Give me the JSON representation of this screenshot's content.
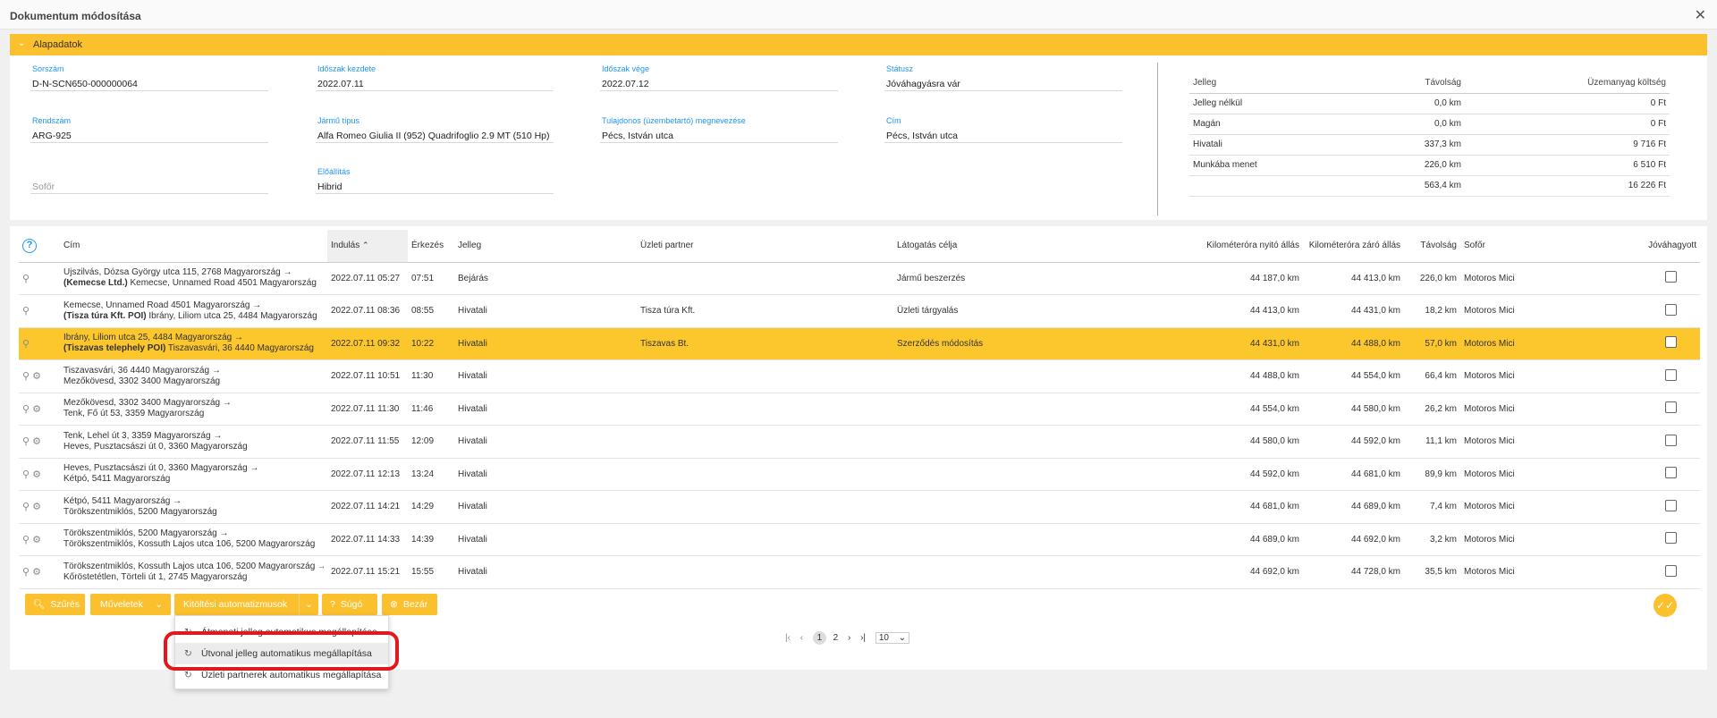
{
  "window": {
    "title": "Dokumentum módosítása",
    "close_icon": "close-icon"
  },
  "section": {
    "label": "Alapadatok"
  },
  "fields": {
    "sorszam": {
      "label": "Sorszám",
      "value": "D-N-SCN650-000000064"
    },
    "idoszak_kezdete": {
      "label": "Időszak kezdete",
      "value": "2022.07.11"
    },
    "idoszak_vege": {
      "label": "Időszak vége",
      "value": "2022.07.12"
    },
    "statusz": {
      "label": "Státusz",
      "value": "Jóváhagyásra vár"
    },
    "rendszam": {
      "label": "Rendszám",
      "value": "ARG-925"
    },
    "jarmu_tipus": {
      "label": "Jármű típus",
      "value": "Alfa Romeo Giulia II (952) Quadrifoglio 2.9 MT (510 Hp)"
    },
    "tulajdonos": {
      "label": "Tulajdonos (üzembetartó) megnevezése",
      "value": "Pécs, István utca"
    },
    "cim": {
      "label": "Cím",
      "value": "Pécs, István utca"
    },
    "sofor": {
      "placeholder": "Sofőr"
    },
    "elotiltas": {
      "label": "Előállítás",
      "value": "Hibrid"
    }
  },
  "summary": {
    "headers": [
      "Jelleg",
      "Távolság",
      "Üzemanyag költség"
    ],
    "rows": [
      [
        "Jelleg nélkül",
        "0,0 km",
        "0 Ft"
      ],
      [
        "Magán",
        "0,0 km",
        "0 Ft"
      ],
      [
        "Hivatali",
        "337,3 km",
        "9 716 Ft"
      ],
      [
        "Munkába menet",
        "226,0 km",
        "6 510 Ft"
      ],
      [
        "",
        "563,4 km",
        "16 226 Ft"
      ]
    ]
  },
  "grid": {
    "headers": {
      "cim": "Cím",
      "indulas": "Indulás",
      "erkezes": "Érkezés",
      "jelleg": "Jelleg",
      "partner": "Üzleti partner",
      "cel": "Látogatás célja",
      "km_nyito": "Kilométeróra nyitó állás",
      "km_zaro": "Kilométeróra záró állás",
      "tavolsag": "Távolság",
      "sofor": "Sofőr",
      "jovahagyott": "Jóváhagyott"
    },
    "sort_icon": "chevron-up-icon",
    "rows": [
      {
        "from": "Újszilvás, Dózsa György utca 115, 2768 Magyarország →",
        "to_bold": "(Kemecse Ltd.)",
        "to": " Kemecse, Unnamed Road 4501 Magyarország",
        "indulas": "2022.07.11 05:27",
        "erkezes": "07:51",
        "jelleg": "Bejárás",
        "partner": "",
        "cel": "Jármű beszerzés",
        "km_nyito": "44 187,0 km",
        "km_zaro": "44 413,0 km",
        "tavolsag": "226,0 km",
        "sofor": "Motoros Mici",
        "gear": false
      },
      {
        "from": "Kemecse, Unnamed Road 4501 Magyarország →",
        "to_bold": "(Tisza túra Kft. POI)",
        "to": " Ibrány, Liliom utca 25, 4484 Magyarország",
        "indulas": "2022.07.11 08:36",
        "erkezes": "08:55",
        "jelleg": "Hivatali",
        "partner": "Tisza túra Kft.",
        "cel": "Üzleti tárgyalás",
        "km_nyito": "44 413,0 km",
        "km_zaro": "44 431,0 km",
        "tavolsag": "18,2 km",
        "sofor": "Motoros Mici",
        "gear": false
      },
      {
        "from": "Ibrány, Liliom utca 25, 4484 Magyarország →",
        "to_bold": "(Tiszavas telephely POI)",
        "to": " Tiszavasvári, 36 4440 Magyarország",
        "indulas": "2022.07.11 09:32",
        "erkezes": "10:22",
        "jelleg": "Hivatali",
        "partner": "Tiszavas Bt.",
        "cel": "Szerződés módosítás",
        "km_nyito": "44 431,0 km",
        "km_zaro": "44 488,0 km",
        "tavolsag": "57,0 km",
        "sofor": "Motoros Mici",
        "gear": false
      },
      {
        "from": "Tiszavasvári, 36 4440 Magyarország →",
        "to_bold": "",
        "to": "Mezőkövesd, 3302 3400 Magyarország",
        "indulas": "2022.07.11 10:51",
        "erkezes": "11:30",
        "jelleg": "Hivatali",
        "partner": "",
        "cel": "",
        "km_nyito": "44 488,0 km",
        "km_zaro": "44 554,0 km",
        "tavolsag": "66,4 km",
        "sofor": "Motoros Mici",
        "gear": true
      },
      {
        "from": "Mezőkövesd, 3302 3400 Magyarország →",
        "to_bold": "",
        "to": "Tenk, Fő út 53, 3359 Magyarország",
        "indulas": "2022.07.11 11:30",
        "erkezes": "11:46",
        "jelleg": "Hivatali",
        "partner": "",
        "cel": "",
        "km_nyito": "44 554,0 km",
        "km_zaro": "44 580,0 km",
        "tavolsag": "26,2 km",
        "sofor": "Motoros Mici",
        "gear": true
      },
      {
        "from": "Tenk, Lehel út 3, 3359 Magyarország →",
        "to_bold": "",
        "to": "Heves, Pusztacsászi út 0, 3360 Magyarország",
        "indulas": "2022.07.11 11:55",
        "erkezes": "12:09",
        "jelleg": "Hivatali",
        "partner": "",
        "cel": "",
        "km_nyito": "44 580,0 km",
        "km_zaro": "44 592,0 km",
        "tavolsag": "11,1 km",
        "sofor": "Motoros Mici",
        "gear": true
      },
      {
        "from": "Heves, Pusztacsászi út 0, 3360 Magyarország →",
        "to_bold": "",
        "to": "Kétpó, 5411 Magyarország",
        "indulas": "2022.07.11 12:13",
        "erkezes": "13:24",
        "jelleg": "Hivatali",
        "partner": "",
        "cel": "",
        "km_nyito": "44 592,0 km",
        "km_zaro": "44 681,0 km",
        "tavolsag": "89,9 km",
        "sofor": "Motoros Mici",
        "gear": true
      },
      {
        "from": "Kétpó, 5411 Magyarország →",
        "to_bold": "",
        "to": "Törökszentmiklós, 5200 Magyarország",
        "indulas": "2022.07.11 14:21",
        "erkezes": "14:29",
        "jelleg": "Hivatali",
        "partner": "",
        "cel": "",
        "km_nyito": "44 681,0 km",
        "km_zaro": "44 689,0 km",
        "tavolsag": "7,4 km",
        "sofor": "Motoros Mici",
        "gear": true
      },
      {
        "from": "Törökszentmiklós, 5200 Magyarország →",
        "to_bold": "",
        "to": "Törökszentmiklós, Kossuth Lajos utca 106, 5200 Magyarország",
        "indulas": "2022.07.11 14:33",
        "erkezes": "14:39",
        "jelleg": "Hivatali",
        "partner": "",
        "cel": "",
        "km_nyito": "44 689,0 km",
        "km_zaro": "44 692,0 km",
        "tavolsag": "3,2 km",
        "sofor": "Motoros Mici",
        "gear": true
      },
      {
        "from": "Törökszentmiklós, Kossuth Lajos utca 106, 5200 Magyarország →",
        "to_bold": "",
        "to": "Kőröstetétlen, Törteli út 1, 2745 Magyarország",
        "indulas": "2022.07.11 15:21",
        "erkezes": "15:55",
        "jelleg": "Hivatali",
        "partner": "",
        "cel": "",
        "km_nyito": "44 692,0 km",
        "km_zaro": "44 728,0 km",
        "tavolsag": "35,5 km",
        "sofor": "Motoros Mici",
        "gear": true
      }
    ]
  },
  "toolbar": {
    "szures": "Szűrés",
    "muveletek": "Műveletek",
    "kitoltesi": "Kitöltési automatizmusok",
    "sugo": "Súgó",
    "bezar": "Bezár"
  },
  "pager": {
    "pages": [
      "1",
      "2"
    ],
    "page_size": "10"
  },
  "dropdown": {
    "items": [
      "Átmeneti jelleg automatikus megállapítása",
      "Útvonal jelleg automatikus megállapítása",
      "Üzleti partnerek automatikus megállapítása"
    ]
  },
  "colors": {
    "accent": "#fbc02d",
    "link": "#2196f3",
    "highlight_ring": "#e3181d"
  }
}
